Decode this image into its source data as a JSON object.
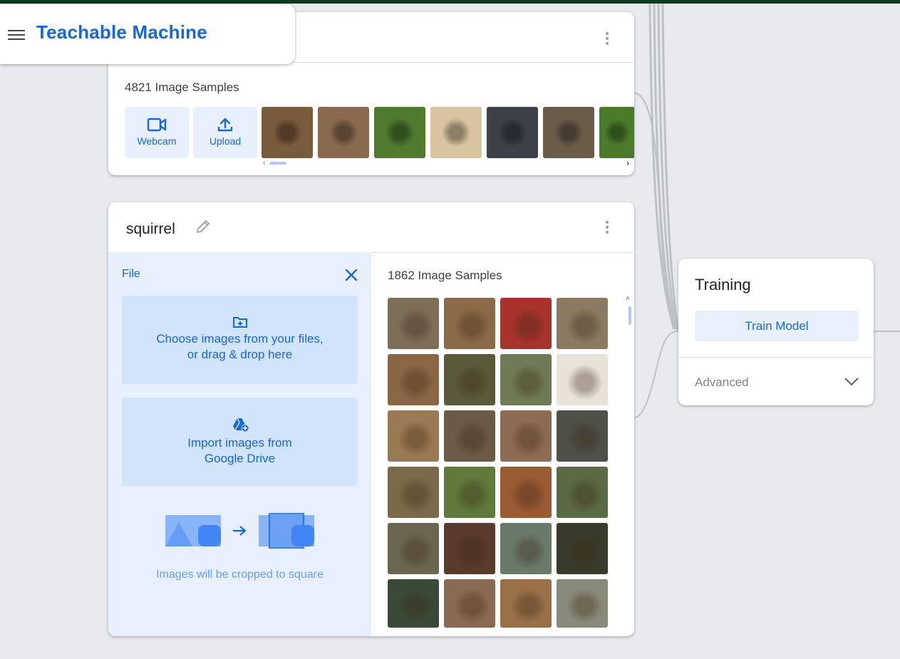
{
  "app": {
    "title": "Teachable Machine"
  },
  "class1": {
    "sample_count": "4821 Image Samples",
    "webcam_label": "Webcam",
    "upload_label": "Upload",
    "thumb_colors": [
      "#7a5a3c",
      "#8a6a4f",
      "#4f7a2f",
      "#d8c4a0",
      "#3c4048",
      "#6b5c4a",
      "#4a7a2a"
    ]
  },
  "class2": {
    "name": "squirrel",
    "sample_count": "1862 Image Samples",
    "file_label": "File",
    "choose_line1": "Choose images from your files,",
    "choose_line2": "or drag & drop here",
    "drive_line1": "Import images from",
    "drive_line2": "Google Drive",
    "crop_note": "Images will be cropped to square",
    "grid_colors": [
      "#7d6e57",
      "#8b6a48",
      "#a8332c",
      "#8a7a62",
      "#8a6644",
      "#5a5a3a",
      "#6f7a55",
      "#e8e2d8",
      "#9a7a54",
      "#6a5a46",
      "#8e6a52",
      "#4e5048",
      "#7a6a4a",
      "#5f7a3a",
      "#9a5a32",
      "#5a6a44",
      "#6a6650",
      "#5a3a2a",
      "#6a7a6a",
      "#3a3a2a",
      "#3a4a38",
      "#8a6a50",
      "#9a7048",
      "#8a8a7a"
    ]
  },
  "training": {
    "title": "Training",
    "train_button": "Train Model",
    "advanced_label": "Advanced"
  }
}
